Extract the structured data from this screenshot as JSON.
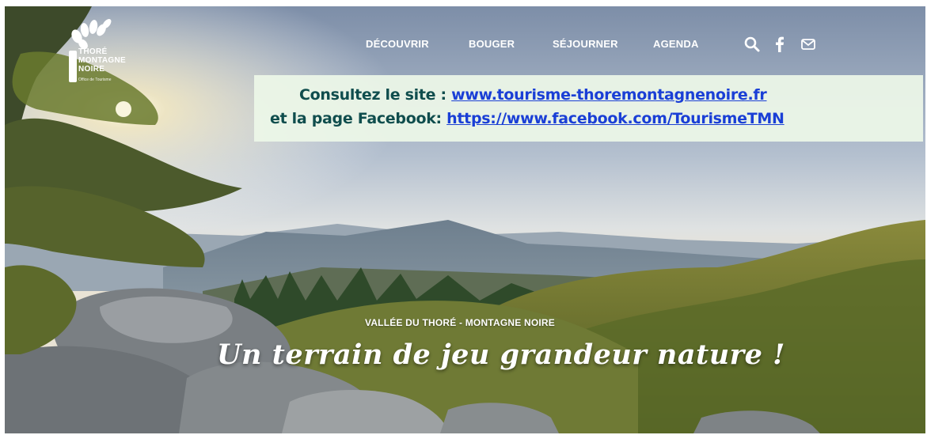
{
  "logo": {
    "line1": "THORÉ",
    "line2": "MONTAGNE",
    "line3": "NOIRE",
    "tagline": "Office de Tourisme"
  },
  "nav": {
    "items": [
      {
        "label": "DÉCOUVRIR"
      },
      {
        "label": "BOUGER"
      },
      {
        "label": "SÉJOURNER"
      },
      {
        "label": "AGENDA"
      }
    ],
    "icons": [
      "search-icon",
      "facebook-icon",
      "mail-icon"
    ]
  },
  "notice": {
    "site_label": "Consultez le site :",
    "site_link": "www.tourisme-thoremontagnenoire.fr",
    "facebook_label": "et la page Facebook:",
    "facebook_link": "https://www.facebook.com/TourismeTMN",
    "label_color": "#0f4d4d",
    "link_color": "#1a3fd6"
  },
  "hero": {
    "kicker": "VALLÉE DU THORÉ - MONTAGNE NOIRE",
    "title": "Un terrain de jeu grandeur nature !"
  }
}
